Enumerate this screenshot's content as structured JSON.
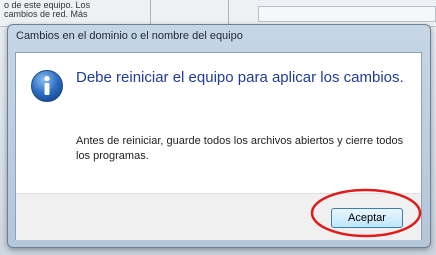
{
  "background": {
    "snippet": "o de este equipo. Los\ncambios de red. Más"
  },
  "dialog": {
    "title": "Cambios en el dominio o el nombre del equipo",
    "icon": "info-icon",
    "main_instruction": "Debe reiniciar el equipo para aplicar los cambios.",
    "body": "Antes de reiniciar, guarde todos los archivos abiertos y cierre todos los programas.",
    "accept_label": "Aceptar"
  },
  "colors": {
    "instruction": "#1f3c9a",
    "annotation": "#e01b1b",
    "icon_blue": "#2f6fc4"
  }
}
